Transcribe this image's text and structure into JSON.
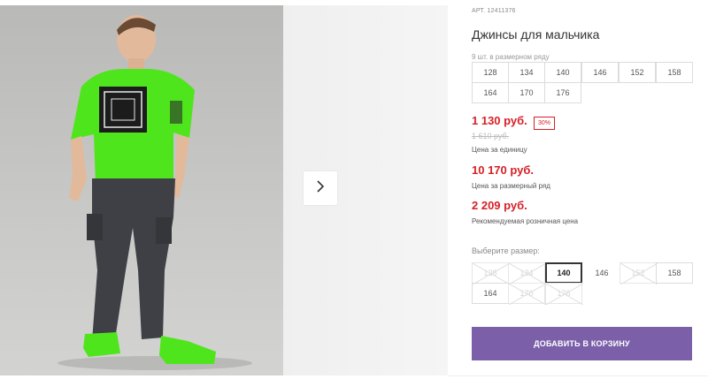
{
  "product": {
    "article": "АРТ. 12411376",
    "title": "Джинсы для мальчика"
  },
  "size_row": {
    "label": "9 шт. в размерном ряду",
    "sizes": [
      "128",
      "134",
      "140",
      "146",
      "152",
      "158",
      "164",
      "170",
      "176"
    ]
  },
  "pricing": {
    "unit_price": "1 130 руб.",
    "discount_badge": "30%",
    "old_price": "1 610 руб.",
    "unit_caption": "Цена за единицу",
    "row_price": "10 170 руб.",
    "row_caption": "Цена за размерный ряд",
    "retail_price": "2 209 руб.",
    "retail_caption": "Рекомендуемая розничная цена"
  },
  "size_select": {
    "label": "Выберите размер:",
    "options": [
      {
        "size": "128",
        "state": "unavailable"
      },
      {
        "size": "134",
        "state": "unavailable"
      },
      {
        "size": "140",
        "state": "selected"
      },
      {
        "size": "146",
        "state": "available"
      },
      {
        "size": "152",
        "state": "unavailable"
      },
      {
        "size": "158",
        "state": "available"
      },
      {
        "size": "164",
        "state": "available"
      },
      {
        "size": "170",
        "state": "unavailable"
      },
      {
        "size": "176",
        "state": "unavailable"
      }
    ]
  },
  "actions": {
    "add_to_cart": "ДОБАВИТЬ В КОРЗИНУ"
  },
  "colors": {
    "accent_button": "#7b60a9",
    "price_red": "#d61f26"
  },
  "icons": {
    "gallery_next": "chevron-right-icon"
  }
}
